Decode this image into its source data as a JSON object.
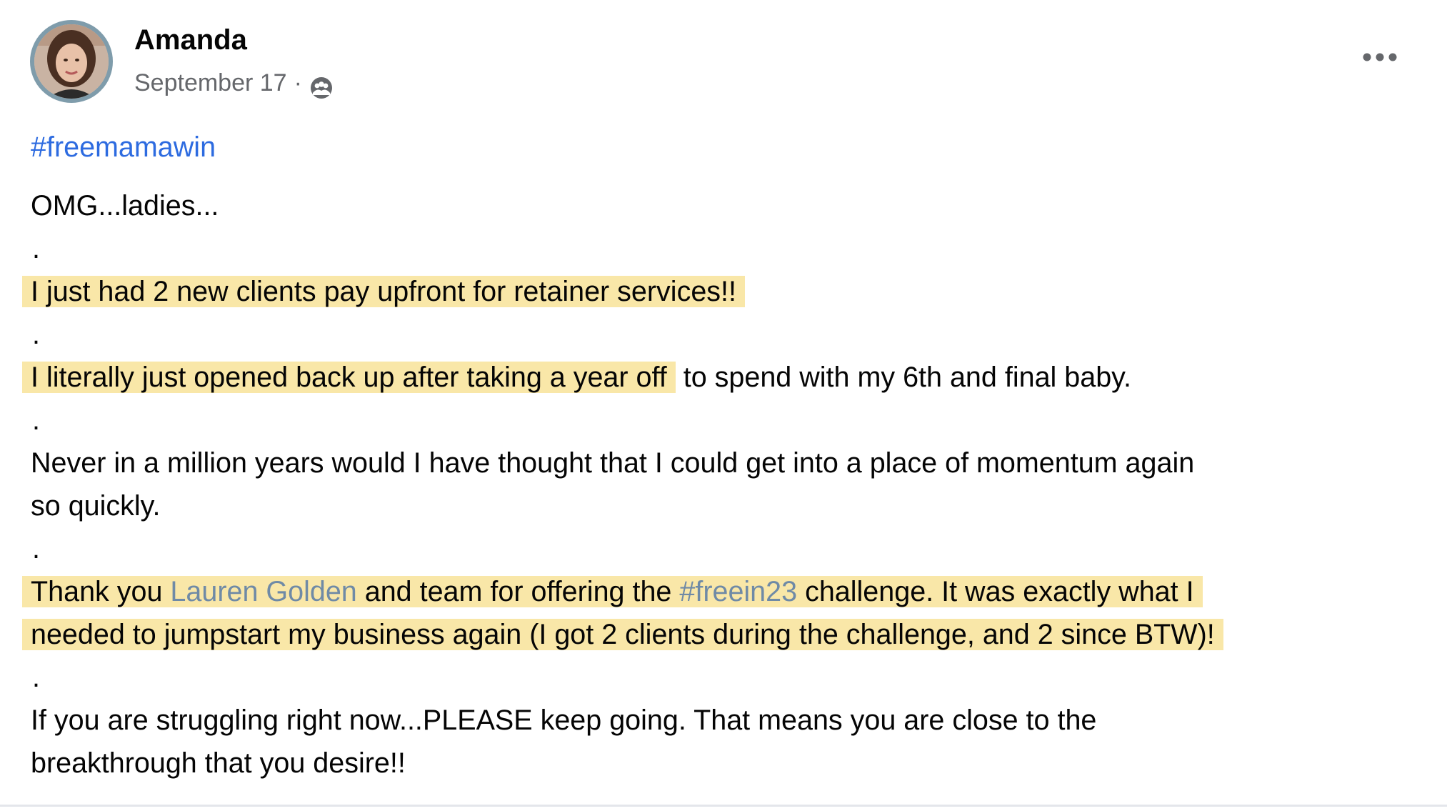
{
  "post": {
    "author": "Amanda",
    "date": "September 17",
    "separator": "·",
    "audience_icon": "group-audience-icon",
    "more_icon": "more-options-icon",
    "hashtag": "#freemamawin",
    "lines": {
      "l1": "OMG...ladies...",
      "dot": ".",
      "l2": "I just had 2 new clients pay upfront for retainer services!!",
      "l3_highlight": "I literally just opened back up after taking a year off",
      "l3_rest": " to spend with my 6th and final baby.",
      "l4a": "Never in a million years would I have thought that I could get into a place of momentum again",
      "l4b": "so quickly.",
      "l5_part1": "Thank you ",
      "l5_mention": "Lauren Golden",
      "l5_part2": " and team for offering the ",
      "l5_hashtag": "#freein23",
      "l5_part3": " challenge. It was exactly what I",
      "l5b": "needed to jumpstart my business again (I got 2 clients during the challenge, and 2 since BTW)!",
      "l6a": "If you are struggling right now...PLEASE keep going. That means you are close to the",
      "l6b": "breakthrough that you desire!!"
    },
    "colors": {
      "highlight": "#f9e7a8",
      "hashtag": "#2d6be0",
      "mention": "#6f8aa6",
      "meta_text": "#65676b",
      "avatar_ring": "#7f9cab"
    }
  }
}
